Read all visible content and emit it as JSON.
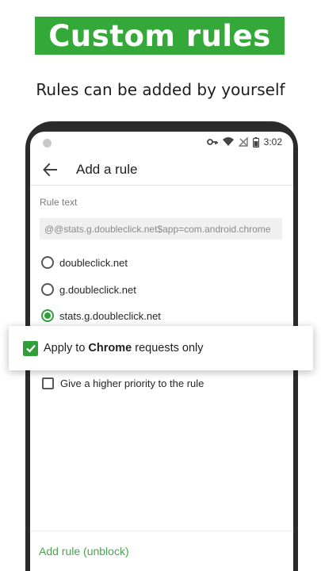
{
  "banner": {
    "title": "Custom rules"
  },
  "subtitle": "Rules can be added by yourself",
  "colors": {
    "brand_green": "#34a93a",
    "accent_green": "#2e9f3b",
    "link_green": "#48a54f"
  },
  "status_bar": {
    "time": "3:02",
    "icons": [
      "camera-dot",
      "key-icon",
      "wifi-icon",
      "no-signal-icon",
      "battery-icon"
    ]
  },
  "app_bar": {
    "title": "Add a rule",
    "back_icon": "arrow-left-icon"
  },
  "form": {
    "rule_text_label": "Rule text",
    "rule_text_value": "@@stats.g.doubleclick.net$app=com.android.chrome",
    "options": [
      {
        "label": "doubleclick.net",
        "selected": false
      },
      {
        "label": "g.doubleclick.net",
        "selected": false
      },
      {
        "label": "stats.g.doubleclick.net",
        "selected": true
      }
    ],
    "apply_chrome": {
      "prefix": "Apply to ",
      "bold": "Chrome",
      "suffix": " requests only",
      "checked": true
    },
    "higher_priority": {
      "label": "Give a higher priority to the rule",
      "checked": false
    },
    "add_rule_label": "Add rule (unblock)"
  }
}
